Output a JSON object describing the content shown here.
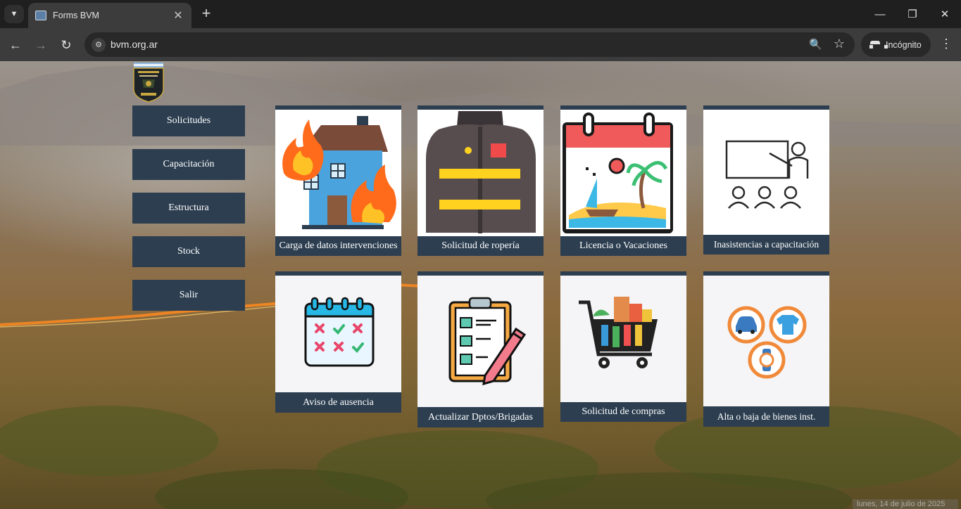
{
  "browser": {
    "tab_title": "Forms BVM",
    "url": "bvm.org.ar",
    "incognito_label": "Incógnito"
  },
  "menu": [
    {
      "label": "Solicitudes"
    },
    {
      "label": "Capacitación"
    },
    {
      "label": "Estructura"
    },
    {
      "label": "Stock"
    },
    {
      "label": "Salir"
    }
  ],
  "cards": [
    {
      "label": "Carga de datos intervenciones",
      "icon": "burning-house-icon"
    },
    {
      "label": "Solicitud de ropería",
      "icon": "firefighter-jacket-icon"
    },
    {
      "label": "Licencia o Vacaciones",
      "icon": "vacation-calendar-icon"
    },
    {
      "label": "Inasistencias a capacitación",
      "icon": "training-class-icon"
    },
    {
      "label": "Aviso de ausencia",
      "icon": "absence-calendar-icon"
    },
    {
      "label": "Actualizar Dptos/Brigadas",
      "icon": "clipboard-checklist-icon"
    },
    {
      "label": "Solicitud de compras",
      "icon": "shopping-cart-icon"
    },
    {
      "label": "Alta o baja de bienes inst.",
      "icon": "assets-icon"
    }
  ],
  "footer": {
    "date_text": "lunes, 14 de julio de 2025"
  },
  "colors": {
    "navy": "#2c3e50",
    "chrome_dark": "#1f1f1f",
    "chrome_bar": "#3c3c3c"
  }
}
